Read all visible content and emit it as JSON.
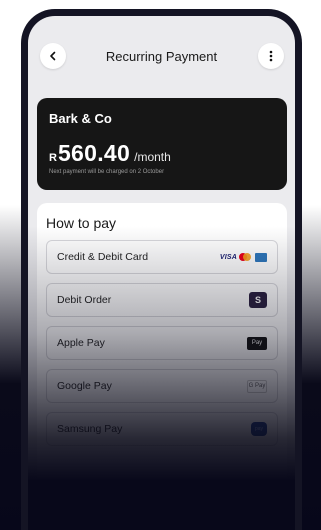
{
  "header": {
    "title": "Recurring Payment",
    "back_icon": "chevron-left-icon",
    "more_icon": "more-vertical-icon"
  },
  "plan": {
    "merchant": "Bark & Co",
    "currency_symbol": "R",
    "amount": "560.40",
    "period": "/month",
    "next_payment_note": "Next payment will be charged on 2 October"
  },
  "payment": {
    "section_title": "How to pay",
    "options": [
      {
        "label": "Credit & Debit Card",
        "icon": "visa-mastercard-amex-logos",
        "logo_text": "VISA"
      },
      {
        "label": "Debit Order",
        "icon": "debit-order-logo",
        "logo_text": "S"
      },
      {
        "label": "Apple Pay",
        "icon": "apple-pay-logo",
        "logo_text": "Pay"
      },
      {
        "label": "Google Pay",
        "icon": "google-pay-logo",
        "logo_text": "G Pay"
      },
      {
        "label": "Samsung Pay",
        "icon": "samsung-pay-logo",
        "logo_text": "pay"
      }
    ]
  },
  "colors": {
    "plan_card_bg": "#161616",
    "screen_bg": "#ebebee",
    "page_bg_dark": "#0a0a1a"
  }
}
